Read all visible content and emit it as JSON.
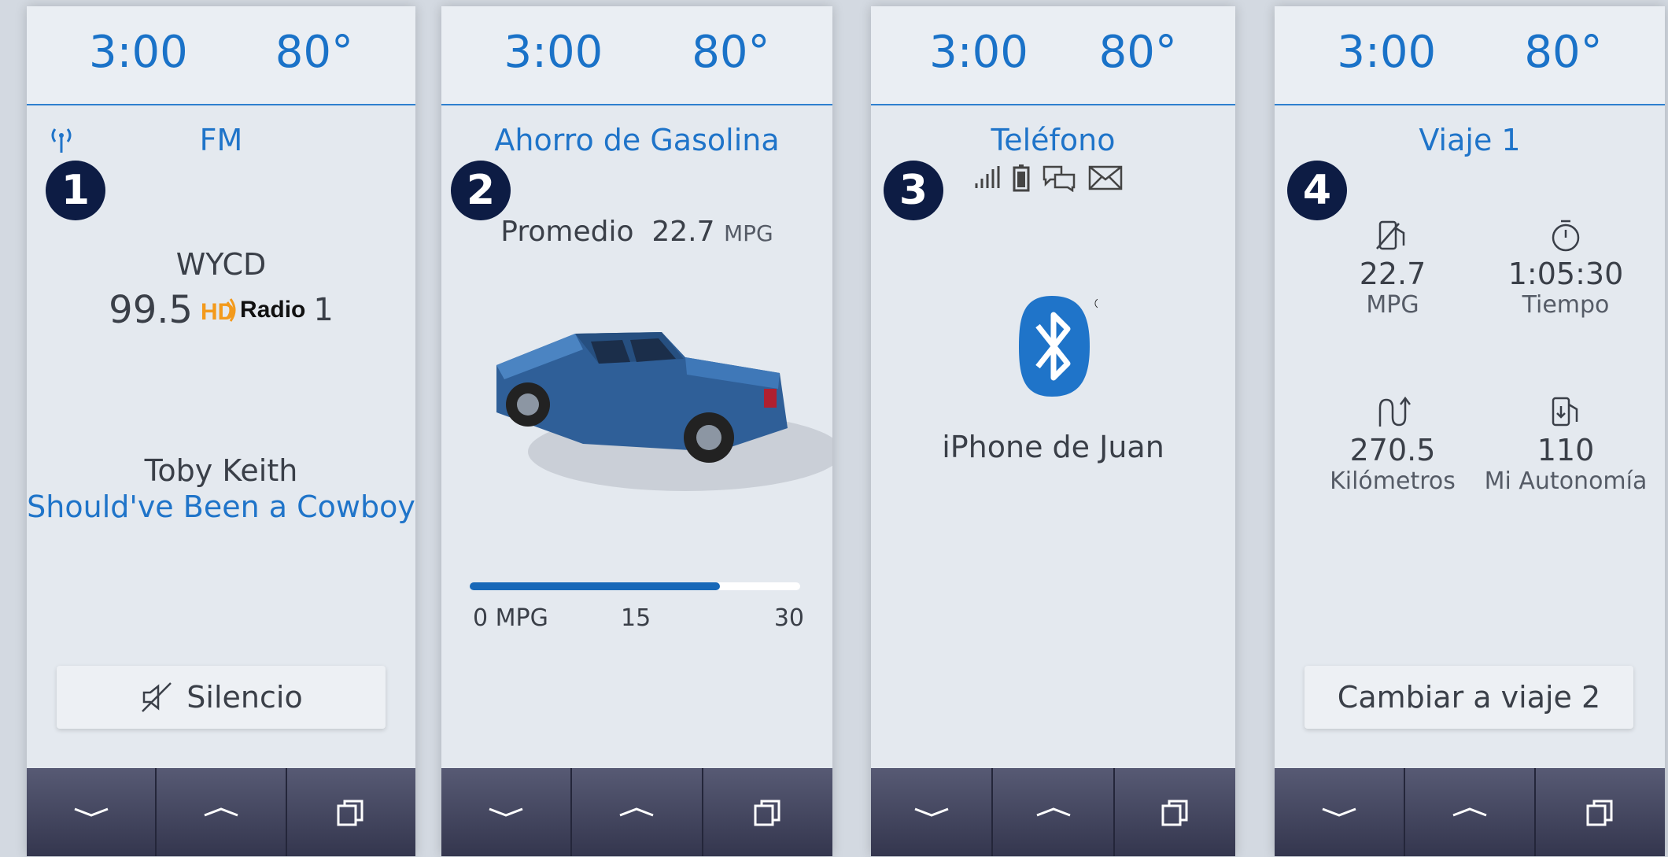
{
  "status": {
    "time": "3:00",
    "temp": "80°"
  },
  "panels": [
    {
      "badge": "1",
      "title": "FM",
      "station_call": "WYCD",
      "frequency": "99.5",
      "hd_label": "Radio",
      "channel": "1",
      "artist": "Toby Keith",
      "song": "Should've Been a Cowboy",
      "button_label": "Silencio"
    },
    {
      "badge": "2",
      "title": "Ahorro de Gasolina",
      "avg_label": "Promedio",
      "avg_value": "22.7",
      "avg_unit": "MPG",
      "gauge": {
        "min_label": "0 MPG",
        "mid_label": "15",
        "max_label": "30",
        "value": 22.7,
        "max": 30
      }
    },
    {
      "badge": "3",
      "title": "Teléfono",
      "device_name": "iPhone de Juan",
      "status_icons": [
        "signal-icon",
        "battery-icon",
        "chat-icon",
        "mail-icon"
      ]
    },
    {
      "badge": "4",
      "title": "Viaje 1",
      "stats": [
        {
          "icon": "fuel-economy-icon",
          "value": "22.7",
          "unit": "MPG"
        },
        {
          "icon": "stopwatch-icon",
          "value": "1:05:30",
          "unit": "Tiempo"
        },
        {
          "icon": "distance-icon",
          "value": "270.5",
          "unit": "Kilómetros"
        },
        {
          "icon": "fuel-range-icon",
          "value": "110",
          "unit": "Mi Autonomía"
        }
      ],
      "button_label": "Cambiar a viaje 2"
    }
  ],
  "colors": {
    "accent": "#1f74c9",
    "badge": "#0d1c44",
    "nav": "#3c3f57"
  }
}
